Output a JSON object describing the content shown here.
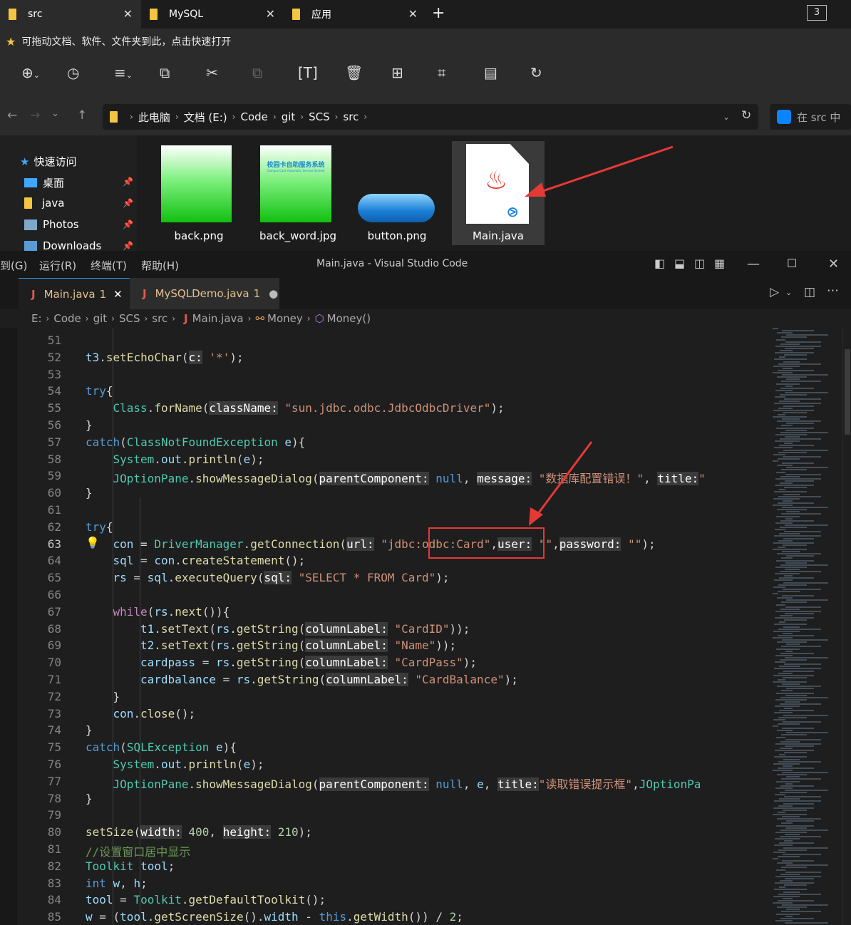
{
  "explorer": {
    "tabs": [
      {
        "label": "src",
        "close": "✕"
      },
      {
        "label": "MySQL",
        "close": "✕"
      },
      {
        "label": "应用",
        "close": "✕"
      }
    ],
    "new_tab": "+",
    "tab_count": "3",
    "favorites_hint": "可拖动文档、软件、文件夹到此，点击快速打开",
    "breadcrumb": [
      "此电脑",
      "文档 (E:)",
      "Code",
      "git",
      "SCS",
      "src"
    ],
    "search_placeholder": "在 src 中",
    "nav_pane": [
      {
        "label": "快速访问",
        "icon": "star-icon"
      },
      {
        "label": "桌面",
        "icon": "desktop-icon"
      },
      {
        "label": "java",
        "icon": "folder-icon"
      },
      {
        "label": "Photos",
        "icon": "photos-icon"
      },
      {
        "label": "Downloads",
        "icon": "downloads-icon"
      }
    ],
    "files": [
      {
        "name": "back.png"
      },
      {
        "name": "back_word.jpg",
        "thumb_text_1": "校园卡自助服务系统",
        "thumb_text_2": "Campus Card Automatic Service System"
      },
      {
        "name": "button.png"
      },
      {
        "name": "Main.java"
      }
    ]
  },
  "vscode": {
    "menus": [
      "到(G)",
      "运行(R)",
      "终端(T)",
      "帮助(H)"
    ],
    "window_title": "Main.java - Visual Studio Code",
    "tabs": [
      {
        "label": "Main.java",
        "badge": "1",
        "icon": "J"
      },
      {
        "label": "MySQLDemo.java",
        "badge": "1",
        "icon": "J"
      }
    ],
    "breadcrumb": [
      "E:",
      "Code",
      "git",
      "SCS",
      "src",
      "Main.java",
      "Money",
      "Money()"
    ],
    "colors": {
      "keyword": "#569cd6",
      "type": "#4ec9b0",
      "function": "#dcdcaa",
      "string": "#ce9178",
      "variable": "#9cdcfe",
      "number": "#b5cea8",
      "comment": "#6a9955",
      "annotation": "#e53935"
    },
    "lines": [
      {
        "n": "51",
        "tokens": []
      },
      {
        "n": "52",
        "tokens": [
          [
            "va",
            "t3"
          ],
          [
            "",
            "."
          ],
          [
            "fn",
            "setEchoChar"
          ],
          [
            "",
            "("
          ],
          [
            "hint",
            "c:"
          ],
          [
            "",
            " "
          ],
          [
            "st",
            "'*'"
          ],
          [
            "",
            ");"
          ]
        ]
      },
      {
        "n": "53",
        "tokens": []
      },
      {
        "n": "54",
        "tokens": [
          [
            "kw",
            "try"
          ],
          [
            "",
            "{"
          ]
        ]
      },
      {
        "n": "55",
        "tokens": [
          [
            "",
            " "
          ],
          [
            "ty",
            "Class"
          ],
          [
            "",
            "."
          ],
          [
            "fn",
            "forName"
          ],
          [
            "",
            "("
          ],
          [
            "hint",
            "className:"
          ],
          [
            "",
            " "
          ],
          [
            "st",
            "\"sun.jdbc.odbc.JdbcOdbcDriver\""
          ],
          [
            "",
            ");"
          ]
        ]
      },
      {
        "n": "56",
        "tokens": [
          [
            "",
            "}"
          ]
        ]
      },
      {
        "n": "57",
        "tokens": [
          [
            "kw",
            "catch"
          ],
          [
            "",
            "("
          ],
          [
            "ty",
            "ClassNotFoundException"
          ],
          [
            "",
            " "
          ],
          [
            "va",
            "e"
          ],
          [
            "",
            "){"
          ]
        ]
      },
      {
        "n": "58",
        "tokens": [
          [
            "",
            " "
          ],
          [
            "ty",
            "System"
          ],
          [
            "",
            "."
          ],
          [
            "va",
            "out"
          ],
          [
            "",
            "."
          ],
          [
            "fn",
            "println"
          ],
          [
            "",
            "("
          ],
          [
            "va",
            "e"
          ],
          [
            "",
            ");"
          ]
        ]
      },
      {
        "n": "59",
        "tokens": [
          [
            "",
            " "
          ],
          [
            "ty",
            "JOptionPane"
          ],
          [
            "",
            "."
          ],
          [
            "fn",
            "showMessageDialog"
          ],
          [
            "",
            "("
          ],
          [
            "hint",
            "parentComponent:"
          ],
          [
            "",
            " "
          ],
          [
            "kw",
            "null"
          ],
          [
            "",
            ", "
          ],
          [
            "hint",
            "message:"
          ],
          [
            "",
            " "
          ],
          [
            "st",
            "\"数据库配置错误！\""
          ],
          [
            "",
            ", "
          ],
          [
            "hint",
            "title:"
          ],
          [
            "",
            ""
          ],
          [
            "st",
            "\""
          ]
        ]
      },
      {
        "n": "60",
        "tokens": [
          [
            "",
            "}"
          ]
        ]
      },
      {
        "n": "61",
        "tokens": []
      },
      {
        "n": "62",
        "tokens": [
          [
            "kw",
            "try"
          ],
          [
            "",
            "{"
          ]
        ]
      },
      {
        "n": "63",
        "tokens": [
          [
            "",
            " "
          ],
          [
            "va",
            "con"
          ],
          [
            "",
            " = "
          ],
          [
            "ty",
            "DriverManager"
          ],
          [
            "",
            "."
          ],
          [
            "fn",
            "getConnection"
          ],
          [
            "",
            "("
          ],
          [
            "hint",
            "url:"
          ],
          [
            "",
            " "
          ],
          [
            "st",
            "\"jdbc:odbc:Card\""
          ],
          [
            "",
            ","
          ],
          [
            "hint",
            "user:"
          ],
          [
            "",
            " "
          ],
          [
            "st",
            "\"\""
          ],
          [
            "",
            ","
          ],
          [
            "hint",
            "password:"
          ],
          [
            "",
            " "
          ],
          [
            "st",
            "\"\""
          ],
          [
            "",
            ");"
          ]
        ]
      },
      {
        "n": "64",
        "tokens": [
          [
            "",
            " "
          ],
          [
            "va",
            "sql"
          ],
          [
            "",
            " = "
          ],
          [
            "va",
            "con"
          ],
          [
            "",
            "."
          ],
          [
            "fn",
            "createStatement"
          ],
          [
            "",
            "();"
          ]
        ]
      },
      {
        "n": "65",
        "tokens": [
          [
            "",
            " "
          ],
          [
            "va",
            "rs"
          ],
          [
            "",
            " = "
          ],
          [
            "va",
            "sql"
          ],
          [
            "",
            "."
          ],
          [
            "fn",
            "executeQuery"
          ],
          [
            "",
            "("
          ],
          [
            "hint",
            "sql:"
          ],
          [
            "",
            " "
          ],
          [
            "st",
            "\"SELECT * FROM Card\""
          ],
          [
            "",
            ");"
          ]
        ]
      },
      {
        "n": "66",
        "tokens": []
      },
      {
        "n": "67",
        "tokens": [
          [
            "",
            " "
          ],
          [
            "ct",
            "while"
          ],
          [
            "",
            "("
          ],
          [
            "va",
            "rs"
          ],
          [
            "",
            "."
          ],
          [
            "fn",
            "next"
          ],
          [
            "",
            "()){"
          ]
        ]
      },
      {
        "n": "68",
        "tokens": [
          [
            "",
            " "
          ],
          [
            "va",
            "t1"
          ],
          [
            "",
            "."
          ],
          [
            "fn",
            "setText"
          ],
          [
            "",
            "("
          ],
          [
            "va",
            "rs"
          ],
          [
            "",
            "."
          ],
          [
            "fn",
            "getString"
          ],
          [
            "",
            "("
          ],
          [
            "hint",
            "columnLabel:"
          ],
          [
            "",
            " "
          ],
          [
            "st",
            "\"CardID\""
          ],
          [
            "",
            "));"
          ]
        ]
      },
      {
        "n": "69",
        "tokens": [
          [
            "",
            " "
          ],
          [
            "va",
            "t2"
          ],
          [
            "",
            "."
          ],
          [
            "fn",
            "setText"
          ],
          [
            "",
            "("
          ],
          [
            "va",
            "rs"
          ],
          [
            "",
            "."
          ],
          [
            "fn",
            "getString"
          ],
          [
            "",
            "("
          ],
          [
            "hint",
            "columnLabel:"
          ],
          [
            "",
            " "
          ],
          [
            "st",
            "\"Name\""
          ],
          [
            "",
            "));"
          ]
        ]
      },
      {
        "n": "70",
        "tokens": [
          [
            "",
            " "
          ],
          [
            "va",
            "cardpass"
          ],
          [
            "",
            " = "
          ],
          [
            "va",
            "rs"
          ],
          [
            "",
            "."
          ],
          [
            "fn",
            "getString"
          ],
          [
            "",
            "("
          ],
          [
            "hint",
            "columnLabel:"
          ],
          [
            "",
            " "
          ],
          [
            "st",
            "\"CardPass\""
          ],
          [
            "",
            ");"
          ]
        ]
      },
      {
        "n": "71",
        "tokens": [
          [
            "",
            " "
          ],
          [
            "va",
            "cardbalance"
          ],
          [
            "",
            " = "
          ],
          [
            "va",
            "rs"
          ],
          [
            "",
            "."
          ],
          [
            "fn",
            "getString"
          ],
          [
            "",
            "("
          ],
          [
            "hint",
            "columnLabel:"
          ],
          [
            "",
            " "
          ],
          [
            "st",
            "\"CardBalance\""
          ],
          [
            "",
            ");"
          ]
        ]
      },
      {
        "n": "72",
        "tokens": [
          [
            "",
            " }"
          ]
        ]
      },
      {
        "n": "73",
        "tokens": [
          [
            "",
            " "
          ],
          [
            "va",
            "con"
          ],
          [
            "",
            "."
          ],
          [
            "fn",
            "close"
          ],
          [
            "",
            "();"
          ]
        ]
      },
      {
        "n": "74",
        "tokens": [
          [
            "",
            "}"
          ]
        ]
      },
      {
        "n": "75",
        "tokens": [
          [
            "kw",
            "catch"
          ],
          [
            "",
            "("
          ],
          [
            "ty",
            "SQLException"
          ],
          [
            "",
            " "
          ],
          [
            "va",
            "e"
          ],
          [
            "",
            "){"
          ]
        ]
      },
      {
        "n": "76",
        "tokens": [
          [
            "",
            " "
          ],
          [
            "ty",
            "System"
          ],
          [
            "",
            "."
          ],
          [
            "va",
            "out"
          ],
          [
            "",
            "."
          ],
          [
            "fn",
            "println"
          ],
          [
            "",
            "("
          ],
          [
            "va",
            "e"
          ],
          [
            "",
            ");"
          ]
        ]
      },
      {
        "n": "77",
        "tokens": [
          [
            "",
            " "
          ],
          [
            "ty",
            "JOptionPane"
          ],
          [
            "",
            "."
          ],
          [
            "fn",
            "showMessageDialog"
          ],
          [
            "",
            "("
          ],
          [
            "hint",
            "parentComponent:"
          ],
          [
            "",
            " "
          ],
          [
            "kw",
            "null"
          ],
          [
            "",
            ", "
          ],
          [
            "va",
            "e"
          ],
          [
            "",
            ", "
          ],
          [
            "hint",
            "title:"
          ],
          [
            "st",
            "\"读取错误提示框\""
          ],
          [
            "",
            ","
          ],
          [
            "ty",
            "JOptionPa"
          ]
        ]
      },
      {
        "n": "78",
        "tokens": [
          [
            "",
            "}"
          ]
        ]
      },
      {
        "n": "79",
        "tokens": []
      },
      {
        "n": "80",
        "tokens": [
          [
            "fn",
            "setSize"
          ],
          [
            "",
            "("
          ],
          [
            "hint",
            "width:"
          ],
          [
            "",
            " "
          ],
          [
            "nu",
            "400"
          ],
          [
            "",
            ", "
          ],
          [
            "hint",
            "height:"
          ],
          [
            "",
            " "
          ],
          [
            "nu",
            "210"
          ],
          [
            "",
            ");"
          ]
        ]
      },
      {
        "n": "81",
        "tokens": [
          [
            "cm",
            "//设置窗口居中显示"
          ]
        ]
      },
      {
        "n": "82",
        "tokens": [
          [
            "ty",
            "Toolkit"
          ],
          [
            "",
            " "
          ],
          [
            "va",
            "tool"
          ],
          [
            "",
            ";"
          ]
        ]
      },
      {
        "n": "83",
        "tokens": [
          [
            "kw",
            "int"
          ],
          [
            "",
            " "
          ],
          [
            "va",
            "w"
          ],
          [
            "",
            ", "
          ],
          [
            "va",
            "h"
          ],
          [
            "",
            ";"
          ]
        ]
      },
      {
        "n": "84",
        "tokens": [
          [
            "va",
            "tool"
          ],
          [
            "",
            " = "
          ],
          [
            "ty",
            "Toolkit"
          ],
          [
            "",
            "."
          ],
          [
            "fn",
            "getDefaultToolkit"
          ],
          [
            "",
            "();"
          ]
        ]
      },
      {
        "n": "85",
        "tokens": [
          [
            "va",
            "w"
          ],
          [
            "",
            " = ("
          ],
          [
            "va",
            "tool"
          ],
          [
            "",
            "."
          ],
          [
            "fn",
            "getScreenSize"
          ],
          [
            "",
            "()."
          ],
          [
            "va",
            "width"
          ],
          [
            "",
            " - "
          ],
          [
            "kw",
            "this"
          ],
          [
            "",
            "."
          ],
          [
            "fn",
            "getWidth"
          ],
          [
            "",
            "()) / "
          ],
          [
            "nu",
            "2"
          ],
          [
            "",
            ";"
          ]
        ]
      }
    ]
  }
}
